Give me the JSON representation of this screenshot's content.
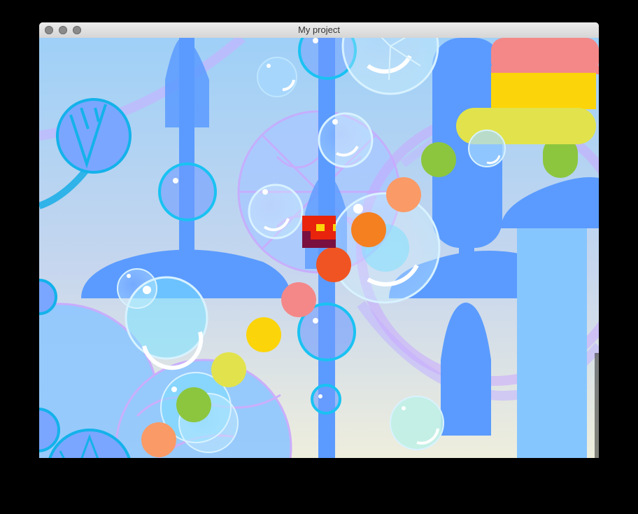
{
  "window": {
    "title": "My project",
    "controls": [
      "close-button",
      "minimize-button",
      "zoom-button"
    ]
  },
  "game": {
    "player_icon": "red-block-character",
    "colors": {
      "sky_top": "#9fd0f7",
      "sky_bottom": "#efeedd",
      "structure_blue": "#5b9bff",
      "bubble_cyan": "#00c8f0",
      "flower_purple": "#c8a8ff",
      "player_red": "#e8240c",
      "pink": "#f48888",
      "yellow": "#fbd40a",
      "lime": "#e2e34c",
      "green": "#8cc63e",
      "orange": "#f48020",
      "salmon": "#fa9a66",
      "red_orange": "#f05422"
    }
  }
}
